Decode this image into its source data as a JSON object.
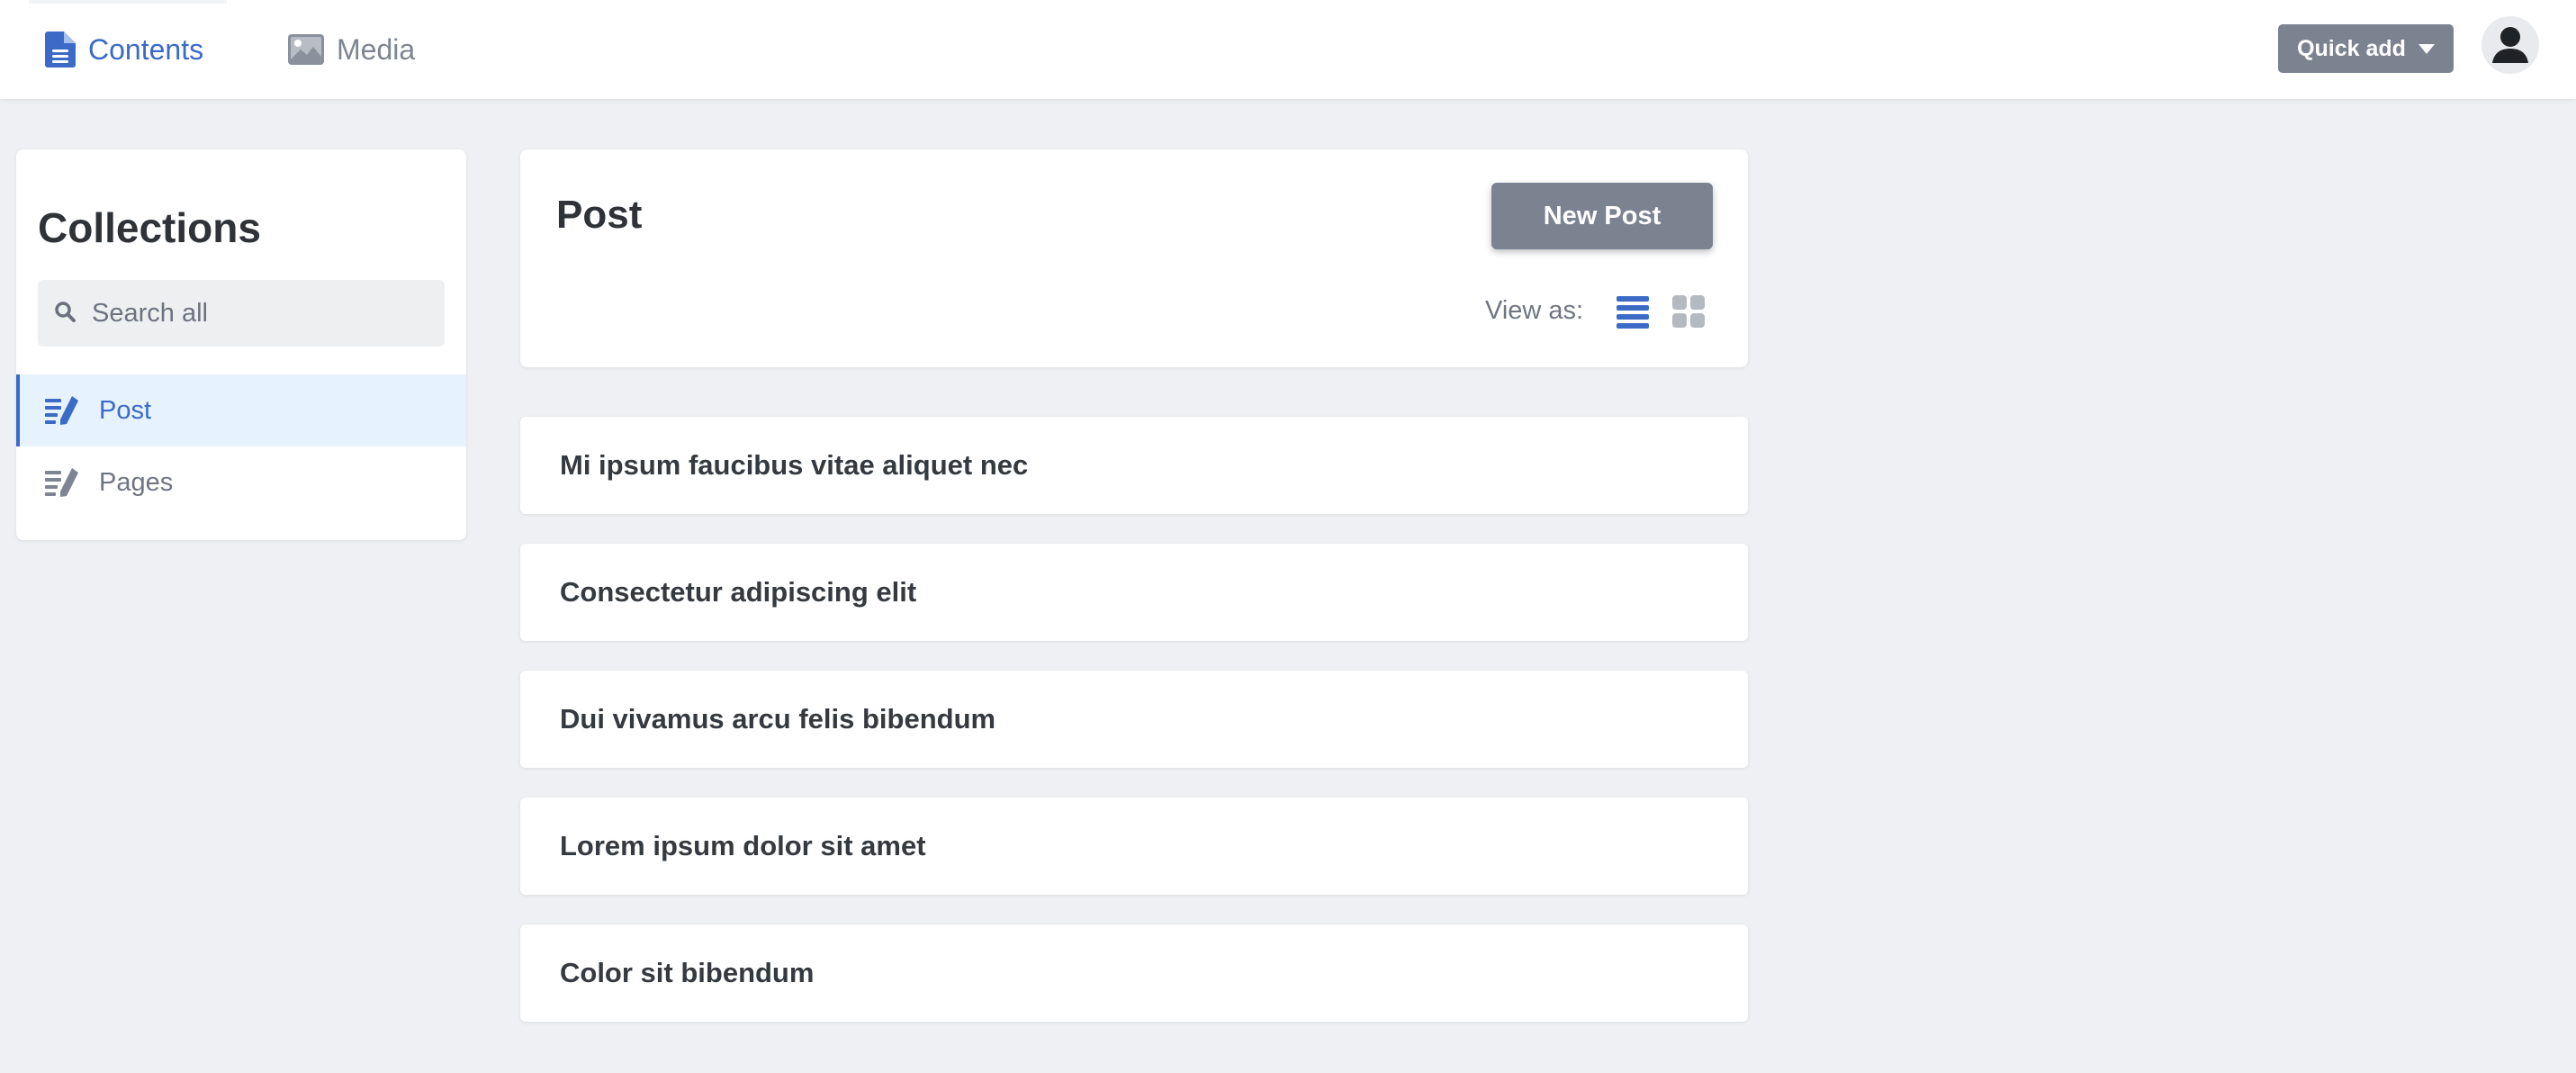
{
  "topbar": {
    "nav": [
      {
        "label": "Contents",
        "icon": "document-icon",
        "active": true
      },
      {
        "label": "Media",
        "icon": "image-icon",
        "active": false
      }
    ],
    "quick_add_label": "Quick add",
    "avatar_icon": "user-icon"
  },
  "sidebar": {
    "title": "Collections",
    "search_placeholder": "Search all",
    "items": [
      {
        "label": "Post",
        "icon": "edit-list-icon",
        "active": true
      },
      {
        "label": "Pages",
        "icon": "edit-list-icon",
        "active": false
      }
    ]
  },
  "main": {
    "title": "Post",
    "new_button_label": "New Post",
    "view_as_label": "View as:",
    "view_modes": [
      {
        "icon": "list-view-icon",
        "active": true
      },
      {
        "icon": "grid-view-icon",
        "active": false
      }
    ],
    "entries": [
      "Mi ipsum faucibus vitae aliquet nec",
      "Consectetur adipiscing elit",
      "Dui vivamus arcu felis bibendum",
      "Lorem ipsum dolor sit amet",
      "Color sit bibendum"
    ]
  },
  "colors": {
    "accent": "#3b6bc6",
    "button_gray": "#7b8391",
    "background": "#eff0f3",
    "active_item_bg": "#e6f2fd"
  }
}
